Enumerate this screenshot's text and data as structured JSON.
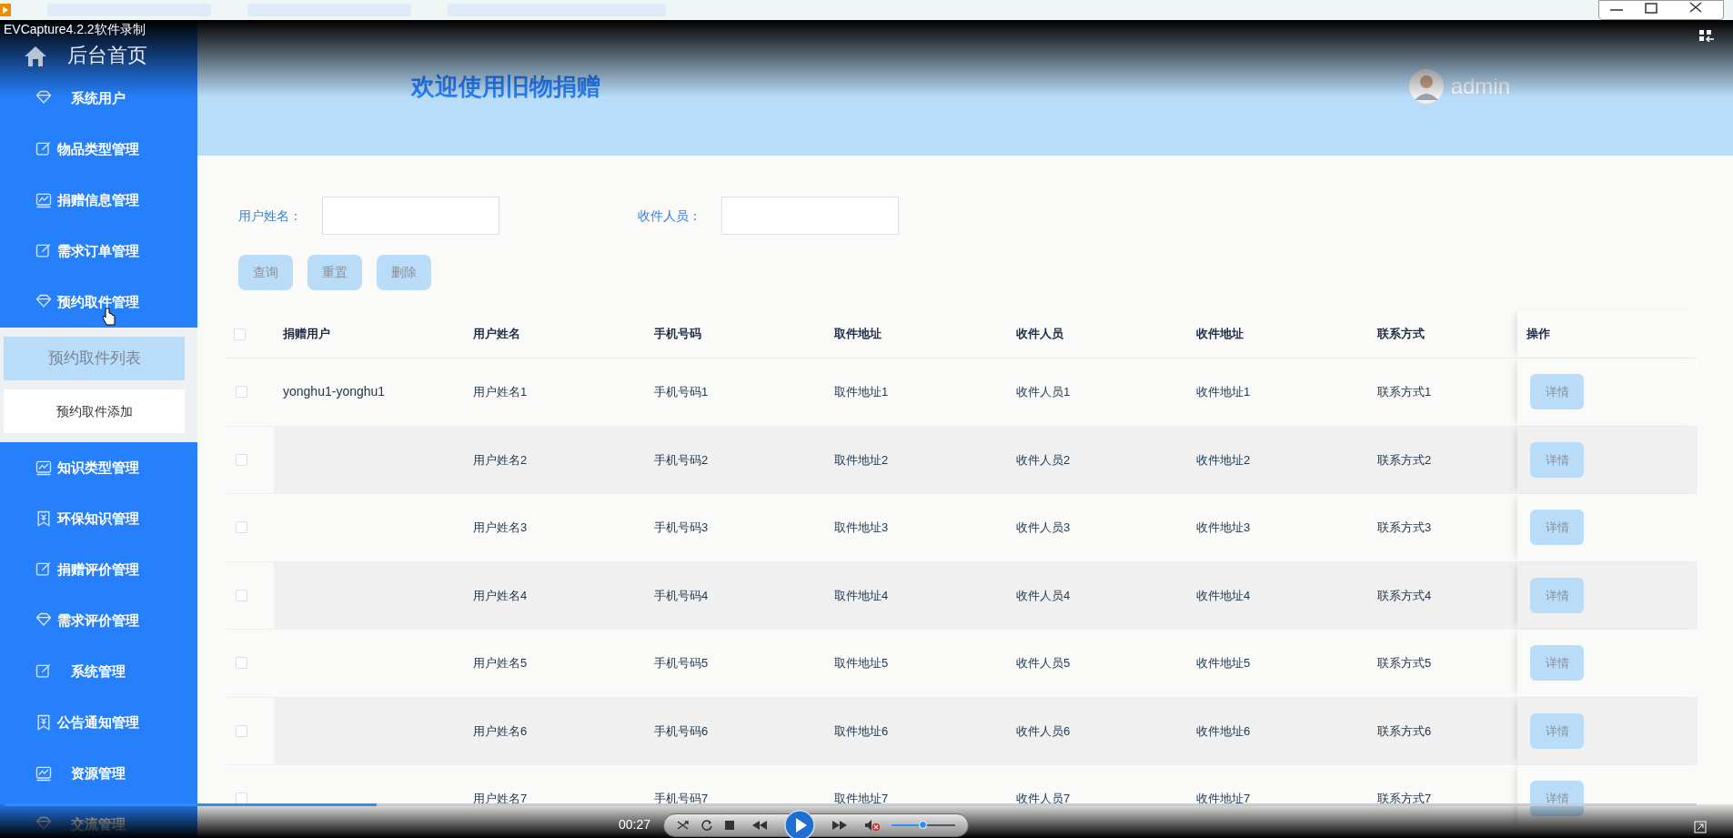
{
  "recorder": {
    "title": "EVCapture4.2.2软件录制"
  },
  "sidebar": {
    "items": [
      {
        "label": "后台首页",
        "kind": "home",
        "pointer": false
      },
      {
        "label": "系统用户",
        "kind": "menu",
        "pointer": false
      },
      {
        "label": "物品类型管理",
        "kind": "menu",
        "pointer": false
      },
      {
        "label": "捐赠信息管理",
        "kind": "menu",
        "pointer": false
      },
      {
        "label": "需求订单管理",
        "kind": "menu",
        "pointer": false
      },
      {
        "label": "预约取件管理",
        "kind": "menu",
        "pointer": true,
        "children": [
          {
            "label": "预约取件列表",
            "selected": true
          },
          {
            "label": "预约取件添加",
            "selected": false
          }
        ]
      },
      {
        "label": "知识类型管理",
        "kind": "menu",
        "pointer": false
      },
      {
        "label": "环保知识管理",
        "kind": "menu",
        "pointer": false
      },
      {
        "label": "捐赠评价管理",
        "kind": "menu",
        "pointer": false
      },
      {
        "label": "需求评价管理",
        "kind": "menu",
        "pointer": false
      },
      {
        "label": "系统管理",
        "kind": "menu",
        "pointer": false
      },
      {
        "label": "公告通知管理",
        "kind": "menu",
        "pointer": false
      },
      {
        "label": "资源管理",
        "kind": "menu",
        "pointer": false
      },
      {
        "label": "交流管理",
        "kind": "menu",
        "pointer": false
      }
    ]
  },
  "header": {
    "title": "欢迎使用旧物捐赠",
    "user": "admin"
  },
  "search": {
    "fields": [
      {
        "label": "用户姓名："
      },
      {
        "label": "收件人员："
      }
    ],
    "buttons": [
      "查询",
      "重置",
      "删除"
    ]
  },
  "table": {
    "columns": [
      "捐赠用户",
      "用户姓名",
      "手机号码",
      "取件地址",
      "收件人员",
      "收件地址",
      "联系方式",
      "操作"
    ],
    "all_checked": false,
    "rows": [
      {
        "checked": false,
        "cells": [
          "yonghu1-yonghu1",
          "用户姓名1",
          "手机号码1",
          "取件地址1",
          "收件人员1",
          "收件地址1",
          "联系方式1"
        ],
        "action": "详情"
      },
      {
        "checked": false,
        "cells": [
          "",
          "用户姓名2",
          "手机号码2",
          "取件地址2",
          "收件人员2",
          "收件地址2",
          "联系方式2"
        ],
        "action": "详情"
      },
      {
        "checked": false,
        "cells": [
          "",
          "用户姓名3",
          "手机号码3",
          "取件地址3",
          "收件人员3",
          "收件地址3",
          "联系方式3"
        ],
        "action": "详情"
      },
      {
        "checked": false,
        "cells": [
          "",
          "用户姓名4",
          "手机号码4",
          "取件地址4",
          "收件人员4",
          "收件地址4",
          "联系方式4"
        ],
        "action": "详情"
      },
      {
        "checked": false,
        "cells": [
          "",
          "用户姓名5",
          "手机号码5",
          "取件地址5",
          "收件人员5",
          "收件地址5",
          "联系方式5"
        ],
        "action": "详情"
      },
      {
        "checked": false,
        "cells": [
          "",
          "用户姓名6",
          "手机号码6",
          "取件地址6",
          "收件人员6",
          "收件地址6",
          "联系方式6"
        ],
        "action": "详情"
      },
      {
        "checked": false,
        "cells": [
          "",
          "用户姓名7",
          "手机号码7",
          "取件地址7",
          "收件人员7",
          "收件地址7",
          "联系方式7"
        ],
        "action": "详情"
      }
    ]
  },
  "player": {
    "time": "00:27",
    "progress": {
      "level": 0.22
    },
    "volume": {
      "level": 0.5
    },
    "muted": true
  }
}
